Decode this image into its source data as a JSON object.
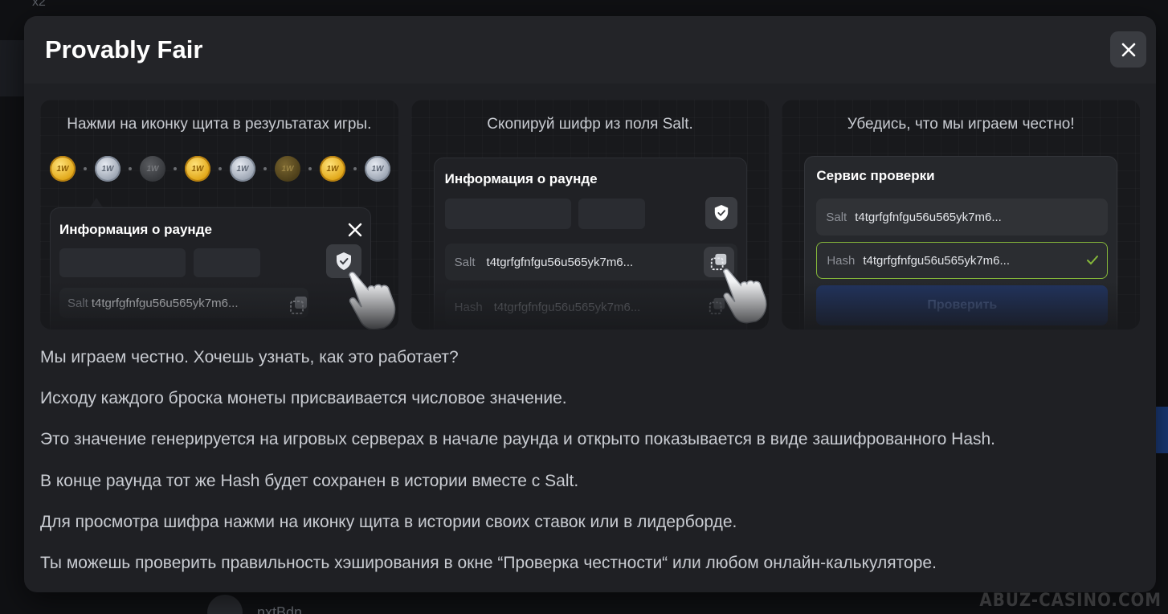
{
  "background": {
    "top_text": "x2",
    "username": "nxtBdn",
    "watermark": "ABUZ-CASINO.COM"
  },
  "modal": {
    "title": "Provably Fair",
    "close_icon": "close-icon"
  },
  "cards": [
    {
      "caption": "Нажми на иконку щита в результатах игры.",
      "coins": [
        "gold",
        "silver",
        "dark",
        "gold",
        "silver",
        "darkgold",
        "gold",
        "silver"
      ],
      "coin_label": "1W",
      "popup_title": "Информация о раунде",
      "salt_label": "Salt",
      "salt_value": "t4tgrfgfnfgu56u565yk7m6..."
    },
    {
      "caption": "Скопируй шифр из поля Salt.",
      "popup_title": "Информация о раунде",
      "salt_label": "Salt",
      "salt_value": "t4tgrfgfnfgu56u565yk7m6...",
      "hash_label": "Hash",
      "hash_value": "t4tgrfgfnfgu56u565yk7m6..."
    },
    {
      "caption": "Убедись, что мы играем честно!",
      "panel_title": "Сервис проверки",
      "salt_label": "Salt",
      "salt_value": "t4tgrfgfnfgu56u565yk7m6...",
      "hash_label": "Hash",
      "hash_value": "t4tgrfgfnfgu56u565yk7m6...",
      "button_label": "Проверить"
    }
  ],
  "paragraphs": [
    "Мы играем честно. Хочешь узнать, как это работает?",
    "Исходу каждого броска монеты присваивается числовое значение.",
    "Это значение генерируется на игровых серверах в начале раунда и открыто показывается в виде зашифрованного Hash.",
    "В конце раунда тот же Hash будет сохранен в истории вместе с Salt.",
    "Для просмотра шифра нажми на иконку щита в истории своих ставок или в лидерборде.",
    "Ты можешь проверить правильность хэширования в окне “Проверка честности“ или любом онлайн-калькуляторе."
  ],
  "colors": {
    "modal_bg": "#1f2024",
    "accent_green": "#86b83a",
    "button_blue": "#22345f"
  }
}
